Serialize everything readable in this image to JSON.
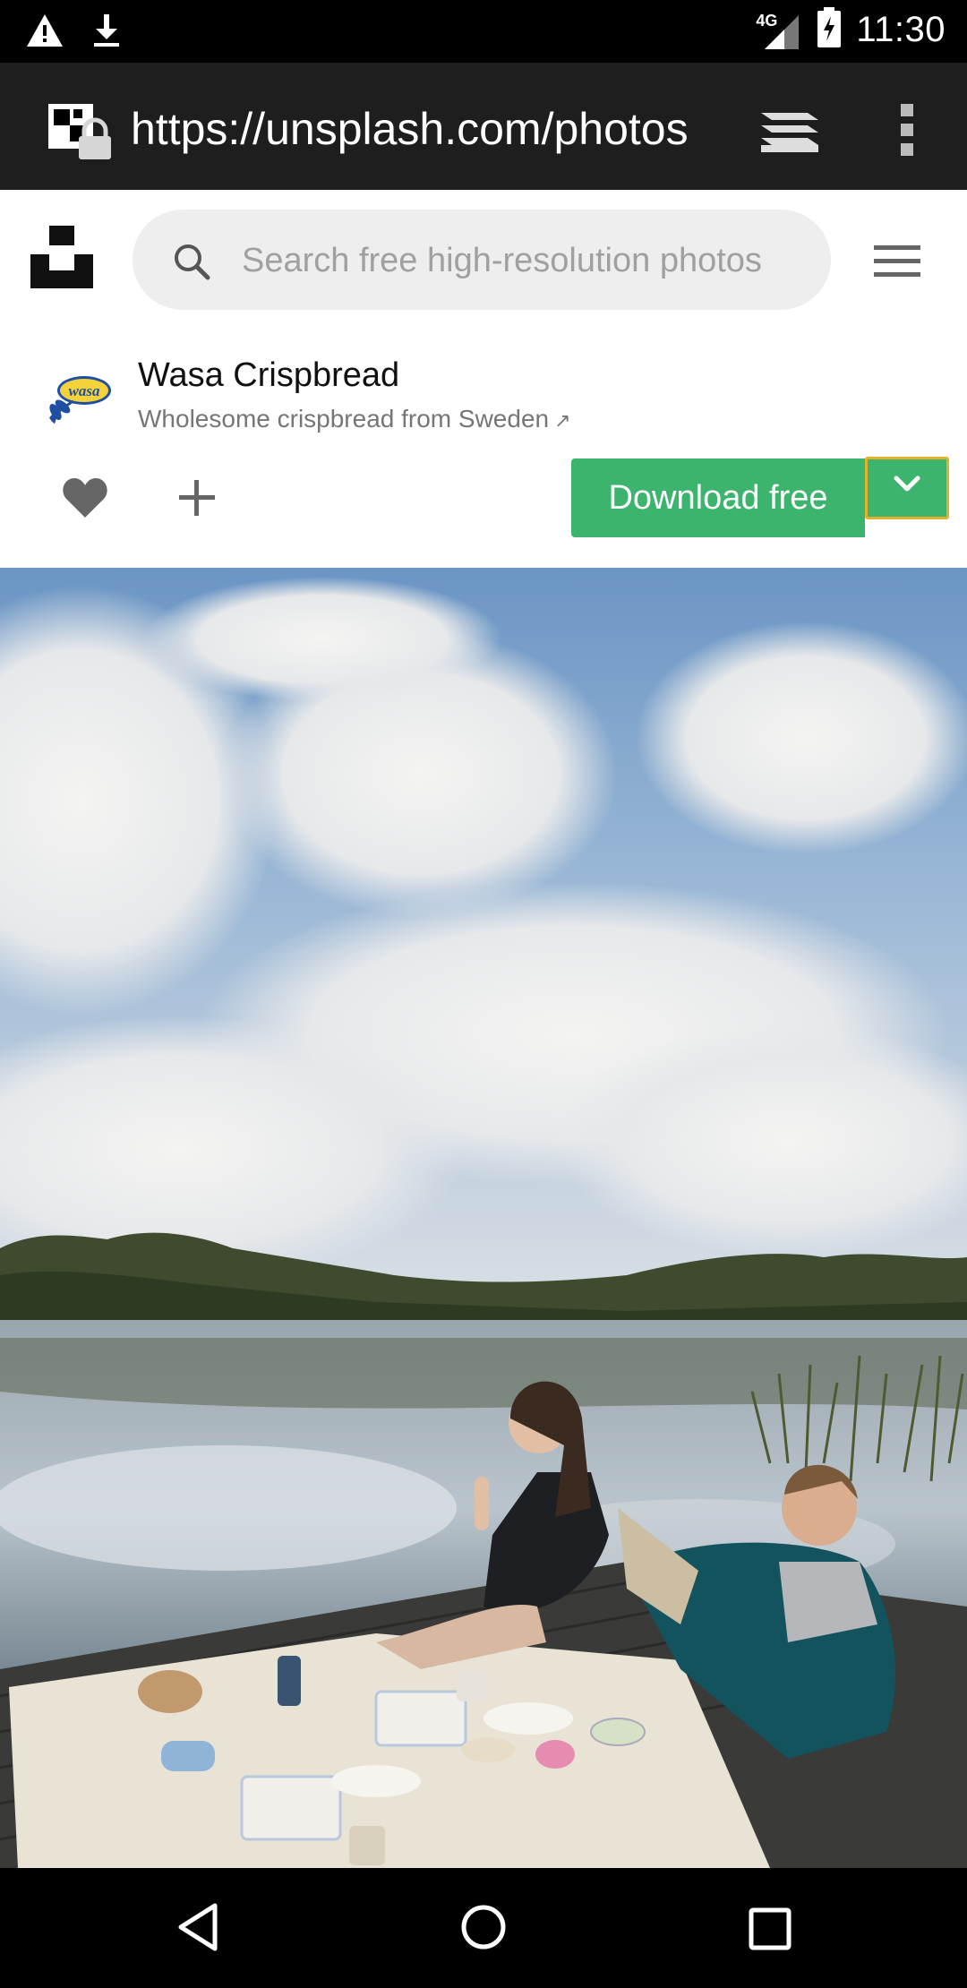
{
  "status_bar": {
    "time": "11:30",
    "network": "4G",
    "icons": [
      "warning-icon",
      "download-icon",
      "signal-icon",
      "battery-charging-icon"
    ]
  },
  "browser": {
    "url": "https://unsplash.com/photos",
    "icons": [
      "site-info-icon",
      "tabs-icon",
      "more-vert-icon"
    ]
  },
  "header": {
    "search_placeholder": "Search free high-resolution photos",
    "icons": [
      "unsplash-logo",
      "search-icon",
      "menu-icon"
    ]
  },
  "brand": {
    "name": "Wasa Crispbread",
    "tagline": "Wholesome crispbread from Sweden",
    "tagline_arrow": "↗",
    "avatar_text": "wasa"
  },
  "actions": {
    "download_label": "Download free",
    "icons": [
      "heart-icon",
      "plus-icon",
      "chevron-down-icon"
    ]
  },
  "colors": {
    "accent_green": "#3cb46e",
    "focus_outline": "#e5b02c",
    "browser_bar": "#1e1e1e"
  },
  "nav_bar": {
    "icons": [
      "back-icon",
      "home-icon",
      "recents-icon"
    ]
  }
}
